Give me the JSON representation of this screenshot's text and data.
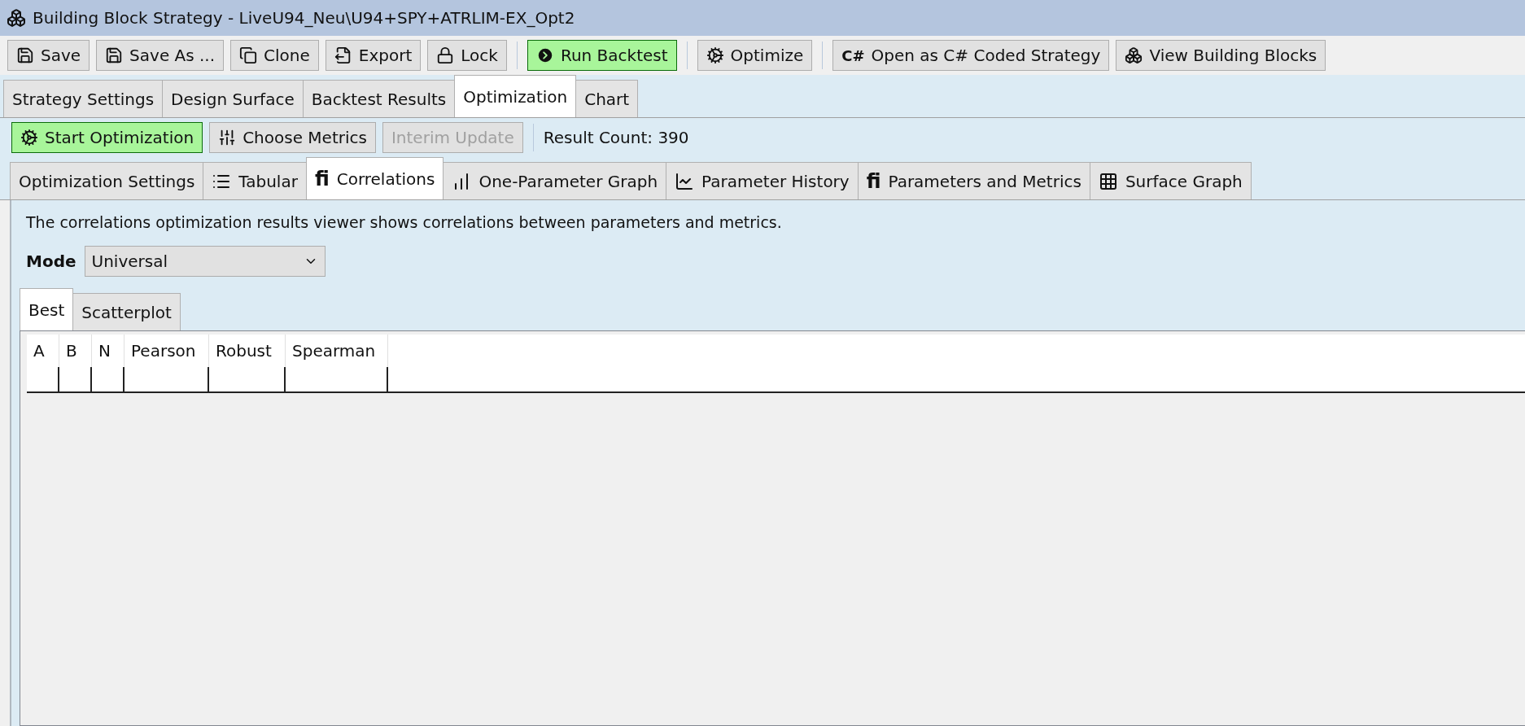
{
  "window": {
    "title": "Building Block Strategy - LiveU94_Neu\\U94+SPY+ATRLIM-EX_Opt2"
  },
  "toolbar": [
    [
      {
        "label": "Save",
        "highlighted": false
      },
      {
        "label": "Save As ...",
        "highlighted": false
      },
      {
        "label": "Clone",
        "highlighted": false
      },
      {
        "label": "Export",
        "highlighted": false
      },
      {
        "label": "Lock",
        "highlighted": false
      }
    ],
    [
      {
        "label": "Run Backtest",
        "highlighted": true
      }
    ],
    [
      {
        "label": "Optimize",
        "highlighted": false
      }
    ],
    [
      {
        "label": "Open as C# Coded Strategy",
        "highlighted": false,
        "badge": "C#"
      },
      {
        "label": "View Building Blocks",
        "highlighted": false
      }
    ]
  ],
  "main_tabs": [
    {
      "label": "Strategy Settings",
      "selected": false
    },
    {
      "label": "Design Surface",
      "selected": false
    },
    {
      "label": "Backtest Results",
      "selected": false
    },
    {
      "label": "Optimization",
      "selected": true
    },
    {
      "label": "Chart",
      "selected": false
    }
  ],
  "optimization_toolbar": {
    "buttons": [
      {
        "label": "Start Optimization",
        "highlighted": true,
        "disabled": false
      },
      {
        "label": "Choose Metrics",
        "highlighted": false,
        "disabled": false
      },
      {
        "label": "Interim Update",
        "highlighted": false,
        "disabled": true
      }
    ],
    "result_count": "Result Count: 390"
  },
  "sub_tabs": [
    {
      "label": "Optimization Settings",
      "selected": false
    },
    {
      "label": "Tabular",
      "selected": false
    },
    {
      "label": "Correlations",
      "selected": true,
      "badge": "fi"
    },
    {
      "label": "One-Parameter Graph",
      "selected": false
    },
    {
      "label": "Parameter History",
      "selected": false
    },
    {
      "label": "Parameters and Metrics",
      "selected": false,
      "badge": "fi"
    },
    {
      "label": "Surface Graph",
      "selected": false
    }
  ],
  "description": "The correlations optimization results viewer shows correlations between parameters and metrics.",
  "mode": {
    "label": "Mode",
    "value": "Universal"
  },
  "result_tabs": [
    {
      "label": "Best",
      "selected": true
    },
    {
      "label": "Scatterplot",
      "selected": false
    }
  ],
  "table": {
    "columns": [
      "A",
      "B",
      "N",
      "Pearson",
      "Robust",
      "Spearman"
    ]
  }
}
